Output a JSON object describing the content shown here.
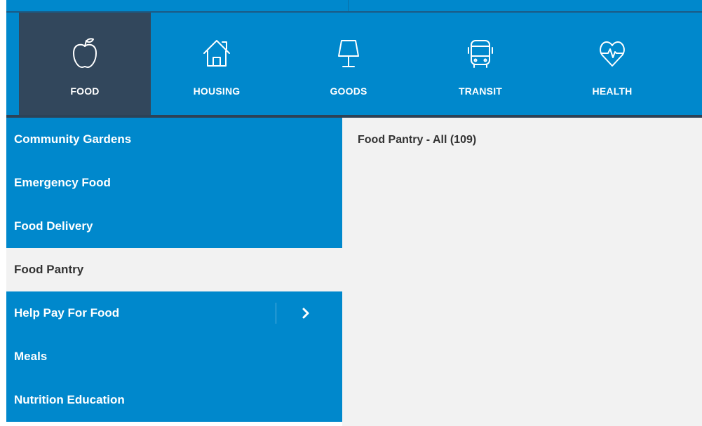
{
  "colors": {
    "primary_blue": "#0088cc",
    "active_tab_dark": "#32475c",
    "selected_item_bg": "#f2f2f2",
    "text_dark": "#333333"
  },
  "categories": [
    {
      "label": "FOOD",
      "icon": "apple-icon",
      "active": true
    },
    {
      "label": "HOUSING",
      "icon": "house-icon",
      "active": false
    },
    {
      "label": "GOODS",
      "icon": "lamp-icon",
      "active": false
    },
    {
      "label": "TRANSIT",
      "icon": "bus-icon",
      "active": false
    },
    {
      "label": "HEALTH",
      "icon": "heart-pulse-icon",
      "active": false
    }
  ],
  "subcategories": [
    {
      "label": "Community Gardens",
      "selected": false,
      "has_children": false
    },
    {
      "label": "Emergency Food",
      "selected": false,
      "has_children": false
    },
    {
      "label": "Food Delivery",
      "selected": false,
      "has_children": false
    },
    {
      "label": "Food Pantry",
      "selected": true,
      "has_children": false
    },
    {
      "label": "Help Pay For Food",
      "selected": false,
      "has_children": true,
      "expand_icon": "chevron-right-icon"
    },
    {
      "label": "Meals",
      "selected": false,
      "has_children": false
    },
    {
      "label": "Nutrition Education",
      "selected": false,
      "has_children": false
    }
  ],
  "content": {
    "results_heading": "Food Pantry - All (109)"
  }
}
